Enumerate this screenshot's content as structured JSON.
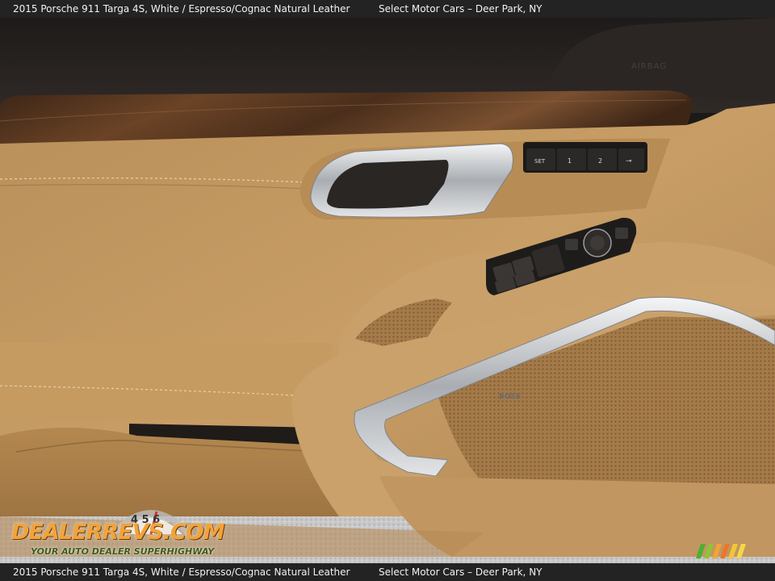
{
  "caption": {
    "title": "2015 Porsche 911 Targa 4S,   White / Espresso/Cognac Natural Leather",
    "dealer": "Select Motor Cars – Deer Park, NY"
  },
  "caption_bottom": {
    "title": "2015 Porsche 911 Targa 4S,   White / Espresso/Cognac Natural Leather",
    "dealer": "Select Motor Cars – Deer Park, NY"
  },
  "door": {
    "airbag_label": "AIRBAG",
    "seat_memory": [
      "SET",
      "1",
      "2",
      "⊸"
    ],
    "speaker_badge": "BOSE"
  },
  "watermark": {
    "brand": "DEALERREVS.COM",
    "tagline": "YOUR AUTO DEALER SUPERHIGHWAY",
    "gauge_digits": "4 5 6"
  },
  "colors": {
    "cognac_leather": "#c49a62",
    "espresso_leather": "#2a2523",
    "wood_trim": "#5a3a22",
    "chrome": "#c9ccd0"
  }
}
